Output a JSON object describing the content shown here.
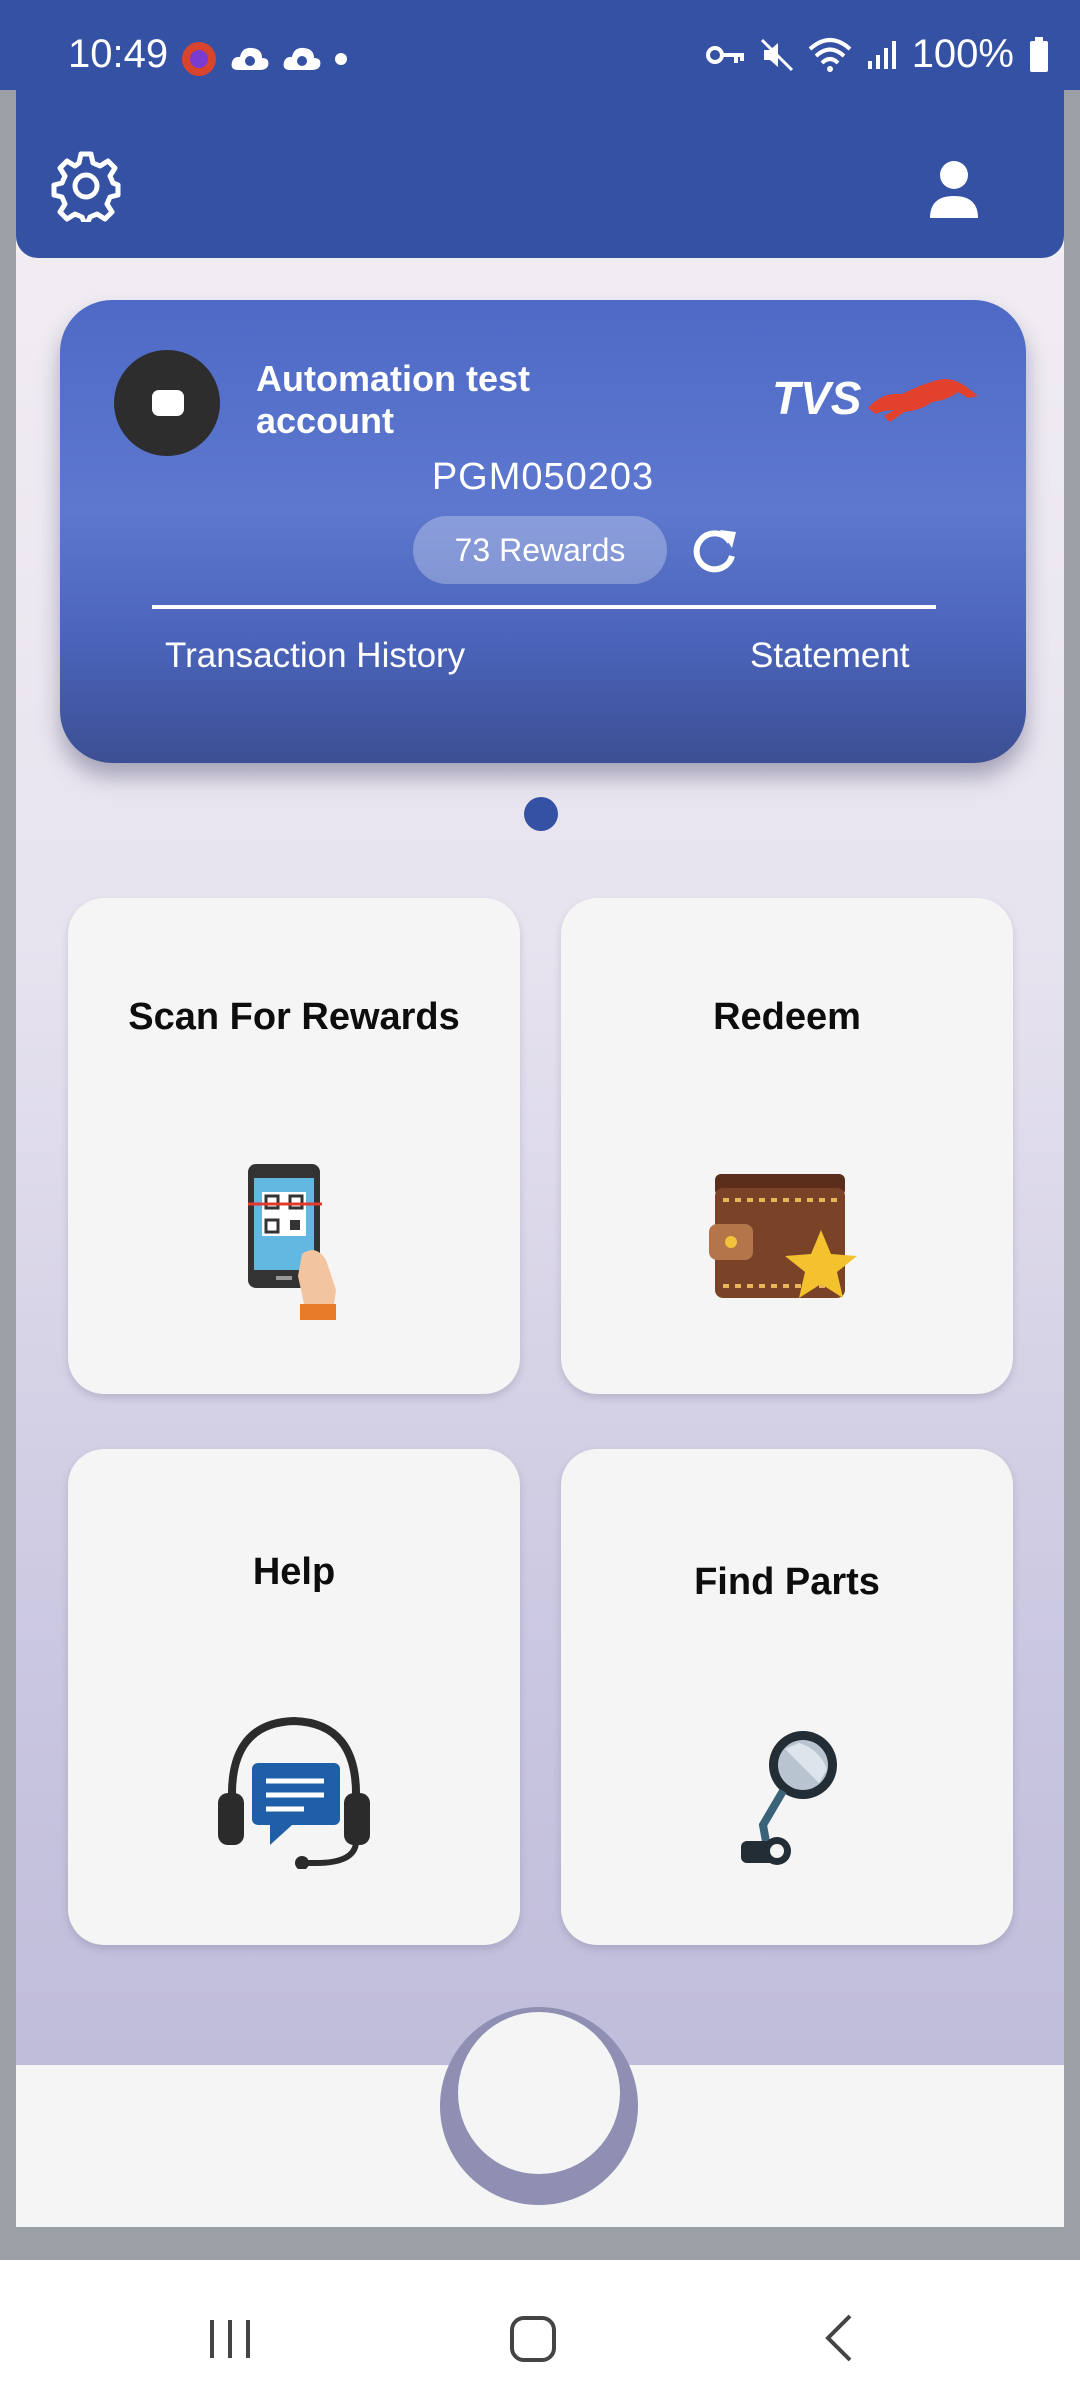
{
  "status_bar": {
    "time": "10:49",
    "battery": "100%",
    "icons": [
      "app-notification-icon",
      "cloud-icon",
      "cloud-icon",
      "dot-icon",
      "vpn-key-icon",
      "mute-icon",
      "wifi-icon",
      "signal-icon",
      "battery-icon"
    ]
  },
  "header": {
    "icons": [
      "gear-icon",
      "profile-icon"
    ]
  },
  "account_card": {
    "name": "Automation test account",
    "brand": "TVS",
    "account_id": "PGM050203",
    "rewards": "73 Rewards",
    "links": {
      "history": "Transaction History",
      "statement": "Statement"
    }
  },
  "tiles": [
    {
      "title": "Scan For Rewards",
      "icon": "qr-scan-icon"
    },
    {
      "title": "Redeem",
      "icon": "wallet-star-icon"
    },
    {
      "title": "Help",
      "icon": "headset-chat-icon"
    },
    {
      "title": "Find Parts",
      "icon": "mirror-part-icon"
    }
  ],
  "colors": {
    "primary": "#3551a4",
    "card_gradient_top": "#4e6ac6",
    "tile_bg": "#f4f5f4",
    "brand_red": "#e2412b"
  },
  "nav": [
    "recent-apps-icon",
    "home-icon",
    "back-icon"
  ]
}
